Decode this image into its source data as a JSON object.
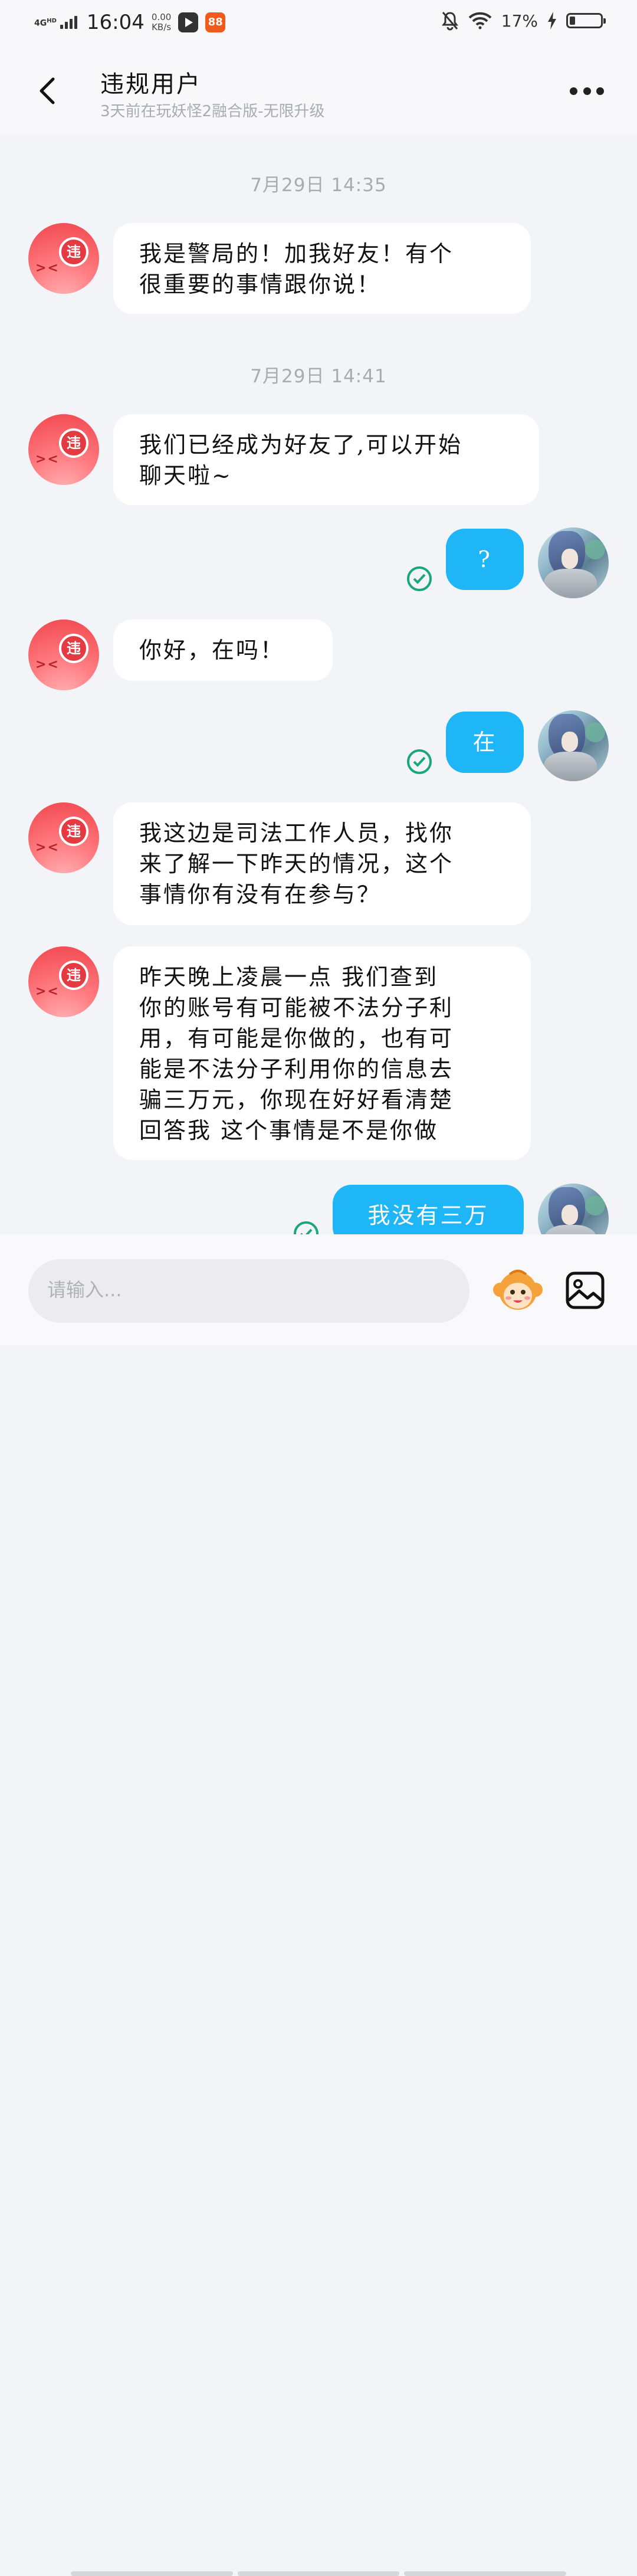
{
  "status_bar": {
    "network": "4G",
    "network_sup": "HD",
    "time": "16:04",
    "speed_value": "0.00",
    "speed_unit": "KB/s",
    "app2_label": "88",
    "battery_percent": "17%",
    "battery_level": 0.17
  },
  "header": {
    "title": "违规用户",
    "subtitle": "3天前在玩妖怪2融合版-无限升级"
  },
  "messages": [
    {
      "type": "timestamp",
      "text": "7月29日 14:35"
    },
    {
      "type": "incoming",
      "avatar_badge": "违",
      "avatar_eyes": "><",
      "lines": [
        "我是警局的！加我好友！有个",
        "很重要的事情跟你说！"
      ]
    },
    {
      "type": "timestamp",
      "text": "7月29日 14:41"
    },
    {
      "type": "incoming",
      "avatar_badge": "违",
      "avatar_eyes": "><",
      "lines": [
        "我们已经成为好友了,可以开始",
        "聊天啦~"
      ]
    },
    {
      "type": "outgoing",
      "text": "?",
      "status": "read-check-icon"
    },
    {
      "type": "incoming",
      "avatar_badge": "违",
      "avatar_eyes": "><",
      "lines": [
        "你好，在吗！"
      ]
    },
    {
      "type": "outgoing",
      "text": "在",
      "status": "read-check-icon"
    },
    {
      "type": "incoming",
      "avatar_badge": "违",
      "avatar_eyes": "><",
      "lines": [
        "我这边是司法工作人员，找你",
        "来了解一下昨天的情况，这个",
        "事情你有没有在参与？"
      ]
    },
    {
      "type": "incoming",
      "avatar_badge": "违",
      "avatar_eyes": "><",
      "lines": [
        "昨天晚上凌晨一点 我们查到",
        "你的账号有可能被不法分子利",
        "用，有可能是你做的，也有可",
        "能是不法分子利用你的信息去",
        "骗三万元，你现在好好看清楚",
        "回答我 这个事情是不是你做"
      ]
    },
    {
      "type": "outgoing",
      "text": "我没有三万",
      "status": "read-check-icon"
    }
  ],
  "input": {
    "placeholder": "请输入..."
  },
  "icons": {
    "back": "back-arrow-icon",
    "more": "more-dots-icon",
    "emoji": "emoji-monkey-icon",
    "image": "image-picker-icon",
    "status_mute": "bell-mute-icon",
    "status_wifi": "wifi-icon",
    "status_charge": "charging-icon"
  },
  "colors": {
    "outgoing_bubble": "#1fb6f8",
    "incoming_bubble": "#ffffff",
    "chat_background": "#f3f4f8",
    "read_check": "#1aa67a",
    "system_avatar": "#f0454c"
  }
}
